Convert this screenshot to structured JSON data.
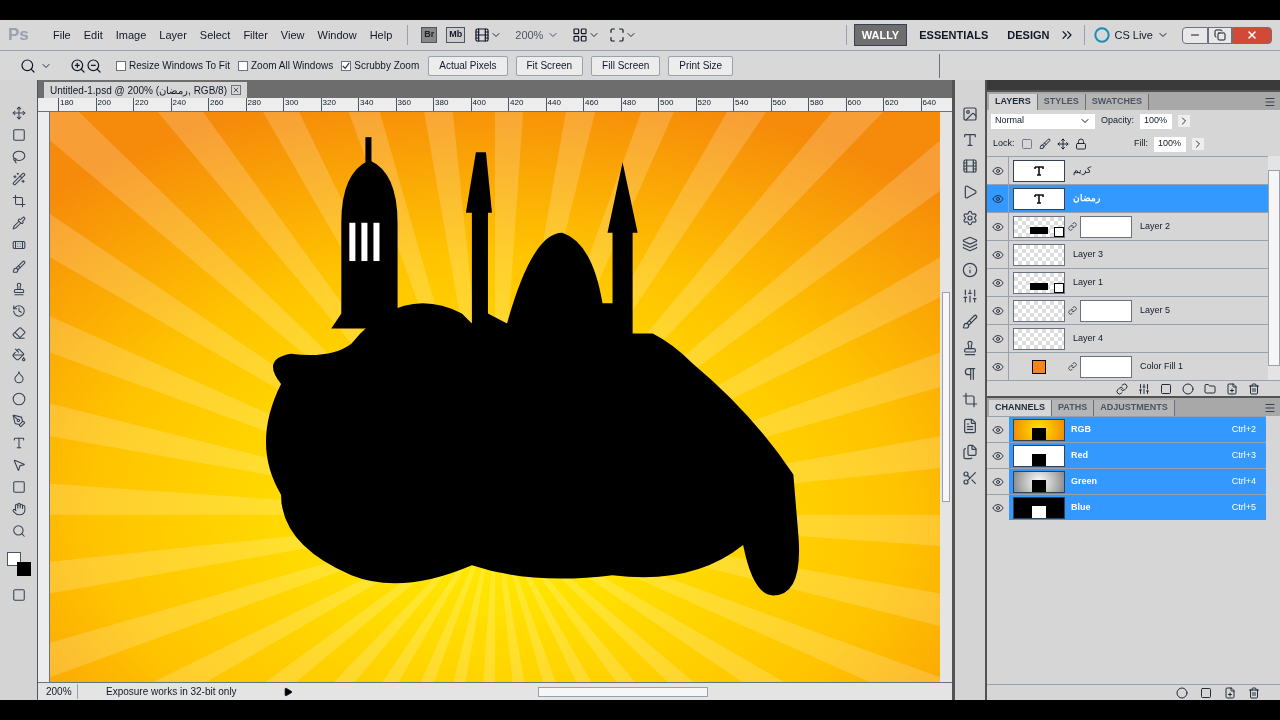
{
  "app_logo": "Ps",
  "menu": [
    "File",
    "Edit",
    "Image",
    "Layer",
    "Select",
    "Filter",
    "View",
    "Window",
    "Help"
  ],
  "app_bar": {
    "bridge": "Br",
    "mini_bridge": "Mb",
    "zoom": "200%"
  },
  "workspaces": [
    {
      "label": "WALLY",
      "selected": true
    },
    {
      "label": "ESSENTIALS",
      "selected": false
    },
    {
      "label": "DESIGN",
      "selected": false
    }
  ],
  "cs_live": "CS Live",
  "options": {
    "checkboxes": [
      {
        "label": "Resize Windows To Fit",
        "checked": false
      },
      {
        "label": "Zoom All Windows",
        "checked": false
      },
      {
        "label": "Scrubby Zoom",
        "checked": true
      }
    ],
    "buttons": [
      "Actual Pixels",
      "Fit Screen",
      "Fill Screen",
      "Print Size"
    ]
  },
  "document": {
    "tab": "Untitled-1.psd @ 200% (رمضان, RGB/8)",
    "ruler": [
      "180",
      "200",
      "220",
      "240",
      "260",
      "280",
      "300",
      "320",
      "340",
      "360",
      "380",
      "400",
      "420",
      "440",
      "460",
      "480",
      "500",
      "520",
      "540",
      "560",
      "580",
      "600",
      "620",
      "640"
    ],
    "status": {
      "zoom": "200%",
      "info": "Exposure works in 32-bit only"
    }
  },
  "layers_panel": {
    "tabs": [
      {
        "label": "LAYERS",
        "selected": true
      },
      {
        "label": "STYLES",
        "selected": false
      },
      {
        "label": "SWATCHES",
        "selected": false
      }
    ],
    "blend_mode": "Normal",
    "opacity_label": "Opacity:",
    "opacity": "100%",
    "lock_label": "Lock:",
    "fill_label": "Fill:",
    "fill": "100%",
    "layers": [
      {
        "name": "كريم",
        "kind": "text",
        "mask": false,
        "selected": false,
        "visible": true
      },
      {
        "name": "رمضان",
        "kind": "text",
        "mask": false,
        "selected": true,
        "visible": true
      },
      {
        "name": "Layer 2",
        "kind": "smart",
        "mask": true,
        "selected": false,
        "visible": true
      },
      {
        "name": "Layer 3",
        "kind": "pixel",
        "mask": false,
        "selected": false,
        "visible": true
      },
      {
        "name": "Layer 1",
        "kind": "smart",
        "mask": false,
        "selected": false,
        "visible": true
      },
      {
        "name": "Layer 5",
        "kind": "pixel",
        "mask": true,
        "selected": false,
        "visible": true
      },
      {
        "name": "Layer 4",
        "kind": "pixel",
        "mask": false,
        "selected": false,
        "visible": true
      },
      {
        "name": "Color Fill 1",
        "kind": "fill",
        "color": "#f7851e",
        "mask": true,
        "selected": false,
        "visible": true
      }
    ]
  },
  "channels_panel": {
    "tabs": [
      {
        "label": "CHANNELS",
        "selected": true
      },
      {
        "label": "PATHS",
        "selected": false
      },
      {
        "label": "ADJUSTMENTS",
        "selected": false
      }
    ],
    "channels": [
      {
        "name": "RGB",
        "kind": "composite",
        "shortcut": "Ctrl+2",
        "selected": true,
        "visible": true
      },
      {
        "name": "Red",
        "kind": "red",
        "shortcut": "Ctrl+3",
        "selected": true,
        "visible": true
      },
      {
        "name": "Green",
        "kind": "green",
        "shortcut": "Ctrl+4",
        "selected": true,
        "visible": true
      },
      {
        "name": "Blue",
        "kind": "blue",
        "shortcut": "Ctrl+5",
        "selected": true,
        "visible": true
      }
    ]
  }
}
